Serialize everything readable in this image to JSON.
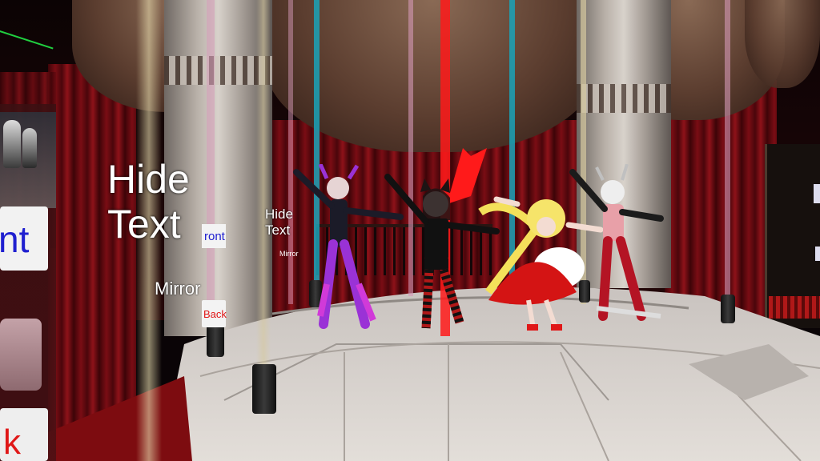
{
  "scene": {
    "type": "VR club stage",
    "colors": {
      "curtain": "#7a0d14",
      "floor": "#d9d4d0",
      "beam_red": "#ff1a1a",
      "beam_cyan": "#1aa3b8",
      "beam_pink": "#d69ab8",
      "beam_gold": "#d6c9a0"
    }
  },
  "mirror_panel": {
    "hide_text_large": "Hide\nText",
    "hide_text_small": "Hide\nText",
    "front_label": "ront",
    "front_small": "ront",
    "mirror_label": "Mirror",
    "mirror_small": "Mirror",
    "back_label": "Back",
    "left_big_letter": "nt",
    "bottom_left_letter": "k"
  },
  "avatars": [
    {
      "name": "purple-armor-avatar"
    },
    {
      "name": "cat-ear-girl-avatar"
    },
    {
      "name": "blonde-red-dress-avatar"
    },
    {
      "name": "silver-hair-red-armor-avatar"
    }
  ]
}
